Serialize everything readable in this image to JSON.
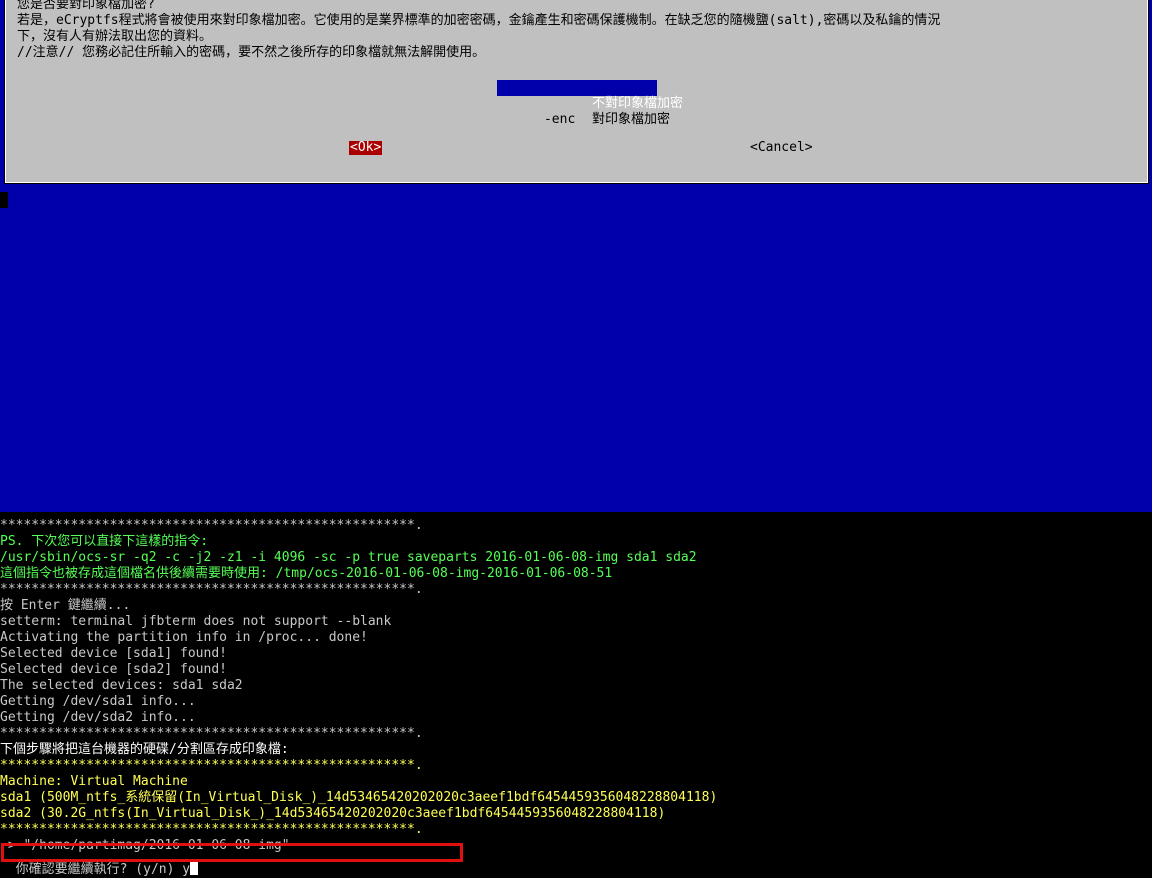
{
  "dialog": {
    "lines": [
      "您是否要對印象檔加密?",
      "若是，eCryptfs程式將會被使用來對印象檔加密。它使用的是業界標準的加密密碼，金鑰產生和密碼保護機制。在缺乏您的隨機鹽(salt),密碼以及私鑰的情況",
      "下，沒有人有辦法取出您的資料。",
      "//注意// 您務必記住所輸入的密碼，要不然之後所存的印象檔就無法解開使用。"
    ],
    "menu": [
      {
        "tag": "",
        "label": "不對印象檔加密",
        "selected": true
      },
      {
        "tag": "-enc",
        "label": "對印象檔加密",
        "selected": false
      }
    ],
    "ok_label": "<Ok>",
    "cancel_label": "<Cancel>"
  },
  "terminal": {
    "lines": [
      {
        "text": "*****************************************************.",
        "color": "white"
      },
      {
        "text": "PS. 下次您可以直接下這樣的指令:",
        "color": "green"
      },
      {
        "text": "/usr/sbin/ocs-sr -q2 -c -j2 -z1 -i 4096 -sc -p true saveparts 2016-01-06-08-img sda1 sda2",
        "color": "green"
      },
      {
        "text": "這個指令也被存成這個檔名供後續需要時使用: /tmp/ocs-2016-01-06-08-img-2016-01-06-08-51",
        "color": "green"
      },
      {
        "text": "*****************************************************.",
        "color": "white"
      },
      {
        "text": "按 Enter 鍵繼續...",
        "color": "white"
      },
      {
        "text": "setterm: terminal jfbterm does not support --blank",
        "color": "white"
      },
      {
        "text": "Activating the partition info in /proc... done!",
        "color": "white"
      },
      {
        "text": "Selected device [sda1] found!",
        "color": "white"
      },
      {
        "text": "Selected device [sda2] found!",
        "color": "white"
      },
      {
        "text": "The selected devices: sda1 sda2",
        "color": "white"
      },
      {
        "text": "Getting /dev/sda1 info...",
        "color": "white"
      },
      {
        "text": "Getting /dev/sda2 info...",
        "color": "white"
      },
      {
        "text": "*****************************************************.",
        "color": "white"
      },
      {
        "text": "下個步驟將把這台機器的硬碟/分割區存成印象檔:",
        "color": "bwhite"
      },
      {
        "text": "*****************************************************.",
        "color": "yellow"
      },
      {
        "text": "Machine: Virtual Machine",
        "color": "yellow"
      },
      {
        "text": "sda1 (500M_ntfs_系統保留(In_Virtual_Disk_)_14d53465420202020c3aeef1bdf645445935604822880411​8)",
        "color": "yellow"
      },
      {
        "text": "sda2 (30.2G_ntfs(In_Virtual_Disk_)_14d53465420202020c3aeef1bdf6454459356048228804118)",
        "color": "yellow"
      },
      {
        "text": "*****************************************************.",
        "color": "yellow"
      },
      {
        "text": "-> \"/home/partimag/2016-01-06-08-img\"",
        "color": "white"
      }
    ],
    "prompt": "你確認要繼續執行? (y/n) y"
  },
  "colors": {
    "dialog_bg": "#c0c0c0",
    "screen_blue": "#0000aa",
    "ok_button": "#aa0000",
    "highlight_border": "#e01010"
  }
}
